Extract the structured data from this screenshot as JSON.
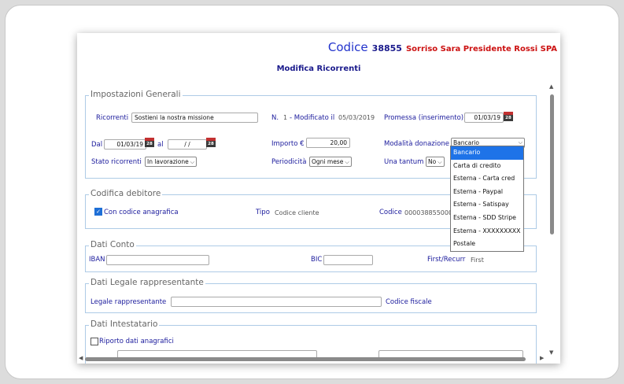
{
  "header": {
    "label": "Codice",
    "number": "38855",
    "organization": "Sorriso Sara Presidente Rossi SPA"
  },
  "page_title": "Modifica Ricorrenti",
  "impostazioni": {
    "legend": "Impostazioni Generali",
    "ricorrenti_label": "Ricorrenti",
    "ricorrenti_value": "Sostieni la nostra missione",
    "n_label": "N.",
    "n_value": "1",
    "modificato_label": "- Modificato il",
    "modificato_value": "05/03/2019",
    "promessa_label": "Promessa (inserimento)",
    "promessa_value": "01/03/19",
    "dal_label": "Dal",
    "dal_value": "01/03/19",
    "al_label": "al",
    "al_value": "/ /",
    "importo_label": "Importo €",
    "importo_value": "20,00",
    "modalita_label": "Modalità donazione",
    "modalita_value": "Bancario",
    "stato_label": "Stato ricorrenti",
    "stato_value": "In lavorazione",
    "periodicita_label": "Periodicità",
    "periodicita_value": "Ogni mese",
    "una_tantum_label": "Una tantum",
    "una_tantum_value": "No",
    "calendar_text": "28"
  },
  "modalita_options": [
    "Bancario",
    "Carta di credito",
    "Esterna - Carta cred",
    "Esterna - Paypal",
    "Esterna - Satispay",
    "Esterna - SDD Stripe",
    "Esterna - XXXXXXXXX",
    "Postale"
  ],
  "codifica": {
    "legend": "Codifica debitore",
    "con_codice_label": "Con codice anagrafica",
    "tipo_label": "Tipo",
    "tipo_value": "Codice cliente",
    "codice_label": "Codice",
    "codice_value": "00003885500000"
  },
  "dati_conto": {
    "legend": "Dati Conto",
    "iban_label": "IBAN",
    "bic_label": "BIC",
    "first_recurr_label": "First/Recurr",
    "first_recurr_value": "First"
  },
  "legale": {
    "legend": "Dati Legale rappresentante",
    "legale_label": "Legale rappresentante",
    "codice_fiscale_label": "Codice fiscale"
  },
  "intestatario": {
    "legend": "Dati Intestatario",
    "riporto_label": "Riporto dati anagrafici"
  },
  "icons": {
    "calendar": "calendar-icon",
    "check": "checkbox-checked-icon",
    "scroll_up": "arrow-up-icon",
    "scroll_down": "arrow-down-icon"
  },
  "colors": {
    "label_blue": "#1a1a9c",
    "highlight": "#1e73e8",
    "org_red": "#cc1111",
    "fieldset_border": "#aecbe6"
  }
}
